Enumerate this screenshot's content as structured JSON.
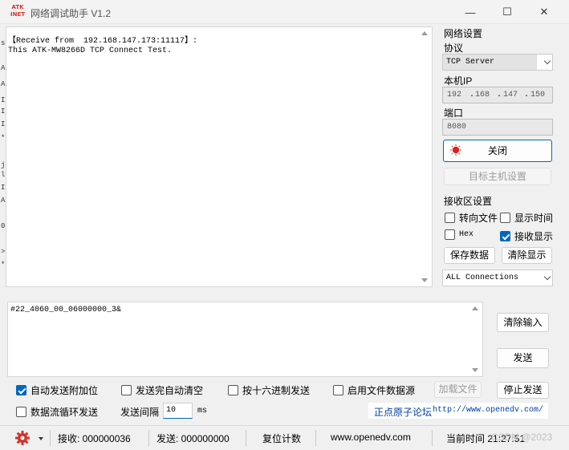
{
  "window": {
    "title": "网络调试助手 V1.2",
    "logo_top": "ATK",
    "logo_bottom": "INET",
    "minimize": "—",
    "maximize": "☐",
    "close": "✕"
  },
  "receive": {
    "lines": "【Receive from  192.168.147.173:11117】:\nThis ATK-MW8266D TCP Connect Test."
  },
  "network": {
    "group_label": "网络设置",
    "protocol_label": "协议",
    "protocol_value": "TCP Server",
    "local_ip_label": "本机IP",
    "ip_1": "192",
    "ip_2": "168",
    "ip_3": "147",
    "ip_4": "150",
    "ip_dot": ".",
    "port_label": "端口",
    "port_value": "8080",
    "close_button": "关闭",
    "target_host_button": "目标主机设置"
  },
  "receive_settings": {
    "group_label": "接收区设置",
    "to_file": "转向文件",
    "show_time": "显示时间",
    "hex": "Hex",
    "show_receive": "接收显示",
    "save_data": "保存数据",
    "clear_display": "清除显示",
    "connections": "ALL Connections"
  },
  "send": {
    "text": "#22_4060_00_06000000_3&",
    "clear_input": "清除输入",
    "send_button": "发送",
    "stop_send": "停止发送",
    "auto_append": "自动发送附加位",
    "auto_clear": "发送完自动清空",
    "hex_send": "按十六进制发送",
    "file_source": "启用文件数据源",
    "load_file": "加载文件",
    "loop_send": "数据流循环发送",
    "interval_label": "发送间隔",
    "interval_value": "10",
    "interval_unit": "ms",
    "forum_label": "正点原子论坛",
    "forum_url": "http://www.openedv.com/"
  },
  "status": {
    "receive": "接收: 000000036",
    "send": "发送: 000000000",
    "reset": "复位计数",
    "website": "www.openedv.com",
    "time": "当前时间 21:27:51",
    "watermark": "CSDN @2023"
  },
  "colors": {
    "accent": "#0067c0",
    "lamp_red": "#e02020",
    "logo_red": "#d4322b",
    "link_blue": "#0040a0"
  }
}
